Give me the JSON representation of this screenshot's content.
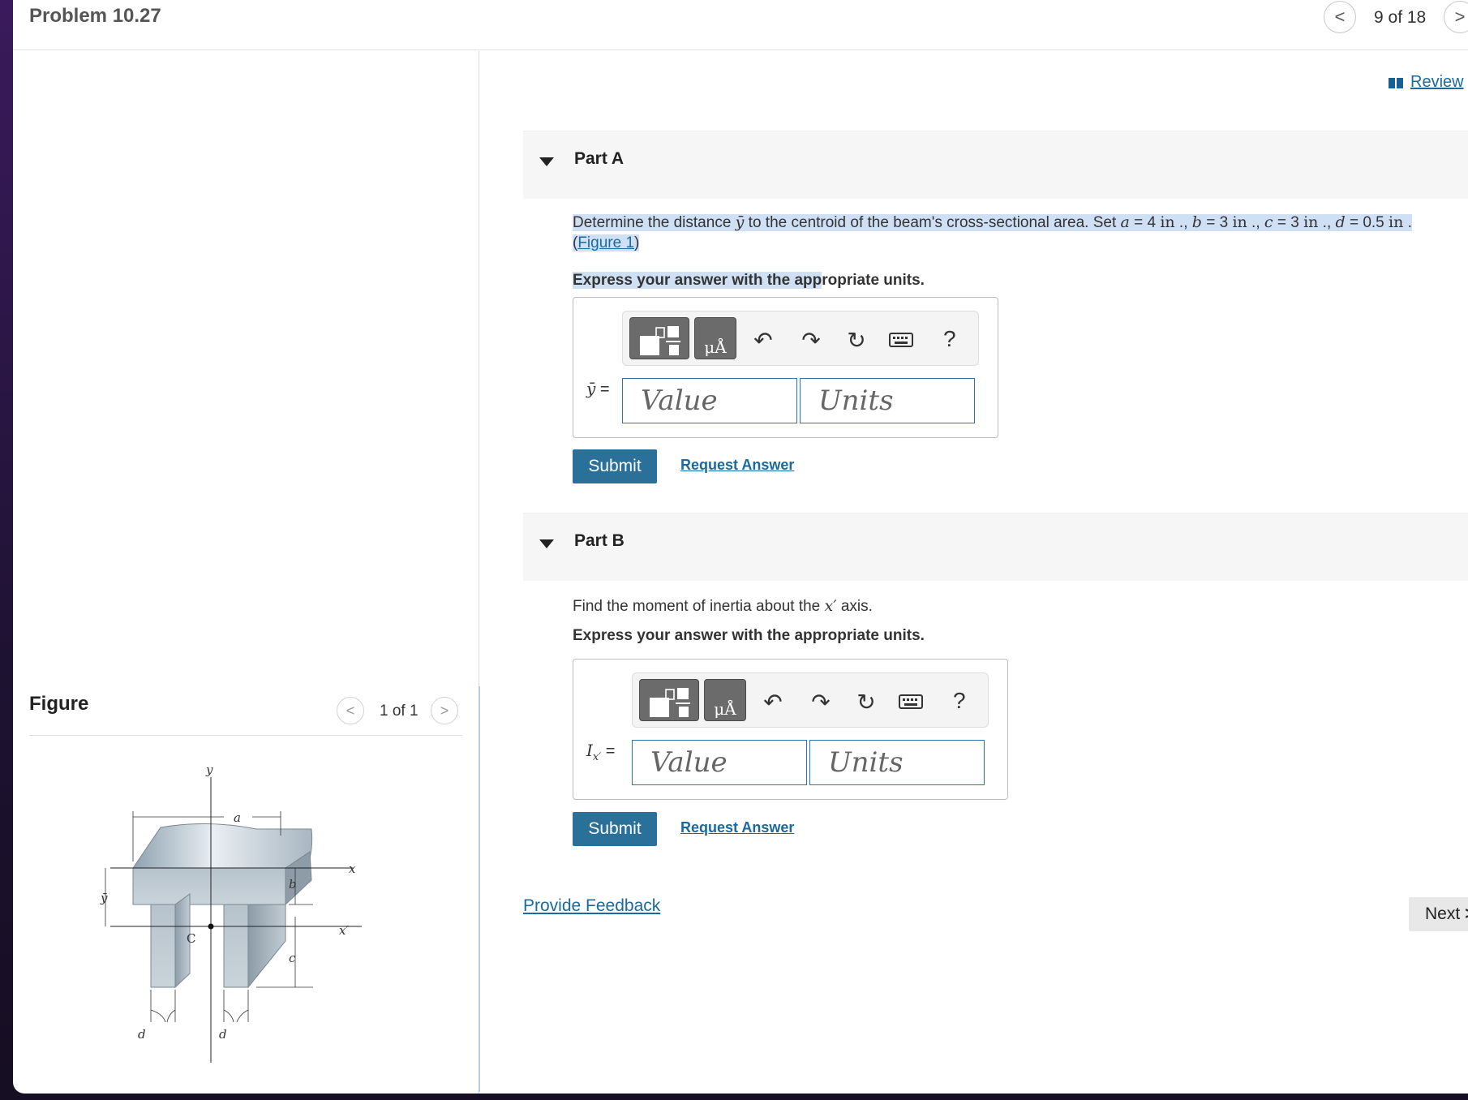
{
  "header": {
    "title": "Problem 10.27",
    "page_count": "9 of 18",
    "prev_glyph": "<",
    "next_glyph": ">"
  },
  "review": {
    "label": " Review"
  },
  "figure": {
    "title": "Figure",
    "count": "1 of 1",
    "labels": {
      "y": "y",
      "a": "a",
      "x": "x",
      "ybar": "ȳ",
      "b": "b",
      "xprime": "x′",
      "C": "C",
      "c": "c",
      "d1": "d",
      "d2": "d"
    }
  },
  "partA": {
    "title": "Part A",
    "q_pre": "Determine the distance ",
    "q_ybar": "ȳ",
    "q_mid": " to the centroid of the beam's cross-sectional area. Set ",
    "a_sym": "a",
    "a_val": " = 4 ",
    "a_unit": "in",
    "sep1": " ., ",
    "b_sym": "b",
    "b_val": " = 3 ",
    "b_unit": "in",
    "sep2": " ., ",
    "c_sym": "c",
    "c_val": " = 3 ",
    "c_unit": "in",
    "sep3": " ., ",
    "d_sym": "d",
    "d_val": " = 0.5 ",
    "d_unit": "in",
    "end": " .",
    "fig_open": "(",
    "fig_link": "Figure 1",
    "fig_close": ")",
    "instruction_hl": "Express your answer with the app",
    "instruction_rest": "ropriate units.",
    "var_sym": "ȳ",
    "var_eq": " =",
    "value_placeholder": "Value",
    "units_placeholder": "Units",
    "submit": "Submit",
    "request": "Request Answer"
  },
  "partB": {
    "title": "Part B",
    "q_pre": "Find the moment of inertia about the ",
    "q_axis": "x′",
    "q_post": " axis.",
    "instruction": "Express your answer with the appropriate units.",
    "var_sym": "I",
    "var_sub": "x′",
    "var_eq": " =",
    "value_placeholder": "Value",
    "units_placeholder": "Units",
    "submit": "Submit",
    "request": "Request Answer"
  },
  "toolbar": {
    "units_glyph": "μÅ",
    "undo": "↶",
    "redo": "↷",
    "reset": "↻",
    "help": "?"
  },
  "footer": {
    "feedback": "Provide Feedback",
    "next": "Next",
    "next_glyph": ">"
  }
}
